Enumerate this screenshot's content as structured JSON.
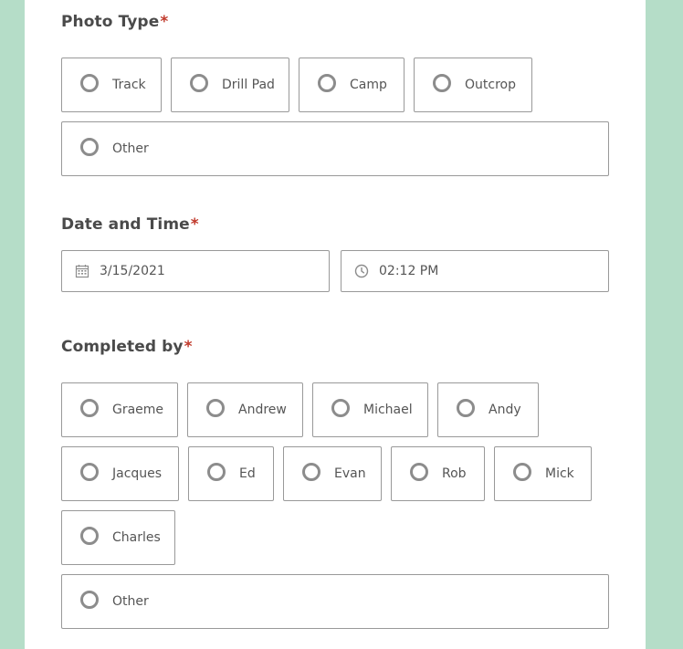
{
  "photo_type": {
    "label": "Photo Type",
    "required_mark": "*",
    "options": [
      "Track",
      "Drill Pad",
      "Camp",
      "Outcrop",
      "Other"
    ]
  },
  "date_time": {
    "label": "Date and Time",
    "required_mark": "*",
    "date_value": "3/15/2021",
    "time_value": "02:12 PM",
    "date_icon": "calendar-icon",
    "time_icon": "clock-icon"
  },
  "completed_by": {
    "label": "Completed by",
    "required_mark": "*",
    "options": [
      "Graeme",
      "Andrew",
      "Michael",
      "Andy",
      "Jacques",
      "Ed",
      "Evan",
      "Rob",
      "Mick",
      "Charles",
      "Other"
    ]
  },
  "colors": {
    "background": "#b5ddc8",
    "required": "#c0392b"
  }
}
